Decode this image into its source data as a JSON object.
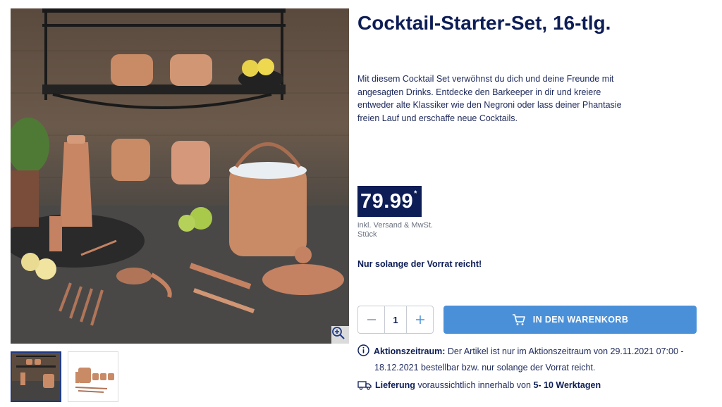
{
  "product": {
    "title": "Cocktail-Starter-Set, 16-tlg.",
    "description": "Mit diesem Cocktail Set verwöhnst du dich und deine Freunde mit angesagten Drinks. Entdecke den Barkeeper in dir und kreiere entweder alte Klassiker wie den Negroni oder lass deiner Phantasie freien Lauf und erschaffe neue Cocktails."
  },
  "price": {
    "value": "79.99",
    "asterisk": "*",
    "vat_note": "inkl. Versand & MwSt.",
    "unit": "Stück"
  },
  "stock_note": "Nur solange der Vorrat reicht!",
  "quantity": {
    "value": "1"
  },
  "cart_button": {
    "label": "IN DEN WARENKORB"
  },
  "promo": {
    "label": "Aktionszeitraum:",
    "text_line1": "Der Artikel ist nur im Aktionszeitraum von 29.11.2021 07:00 -",
    "text_line2": "18.12.2021 bestellbar bzw. nur solange der Vorrat reicht."
  },
  "delivery": {
    "label": "Lieferung",
    "text": "voraussichtlich innerhalb von",
    "days": "5- 10 Werktagen"
  },
  "icons": {
    "zoom": "zoom-in-icon",
    "minus": "minus-icon",
    "plus": "plus-icon",
    "cart": "cart-icon",
    "info": "info-icon",
    "truck": "truck-icon"
  },
  "colors": {
    "brand_navy": "#0d1d56",
    "cart_blue": "#4a90d9",
    "copper": "#c98a66"
  }
}
